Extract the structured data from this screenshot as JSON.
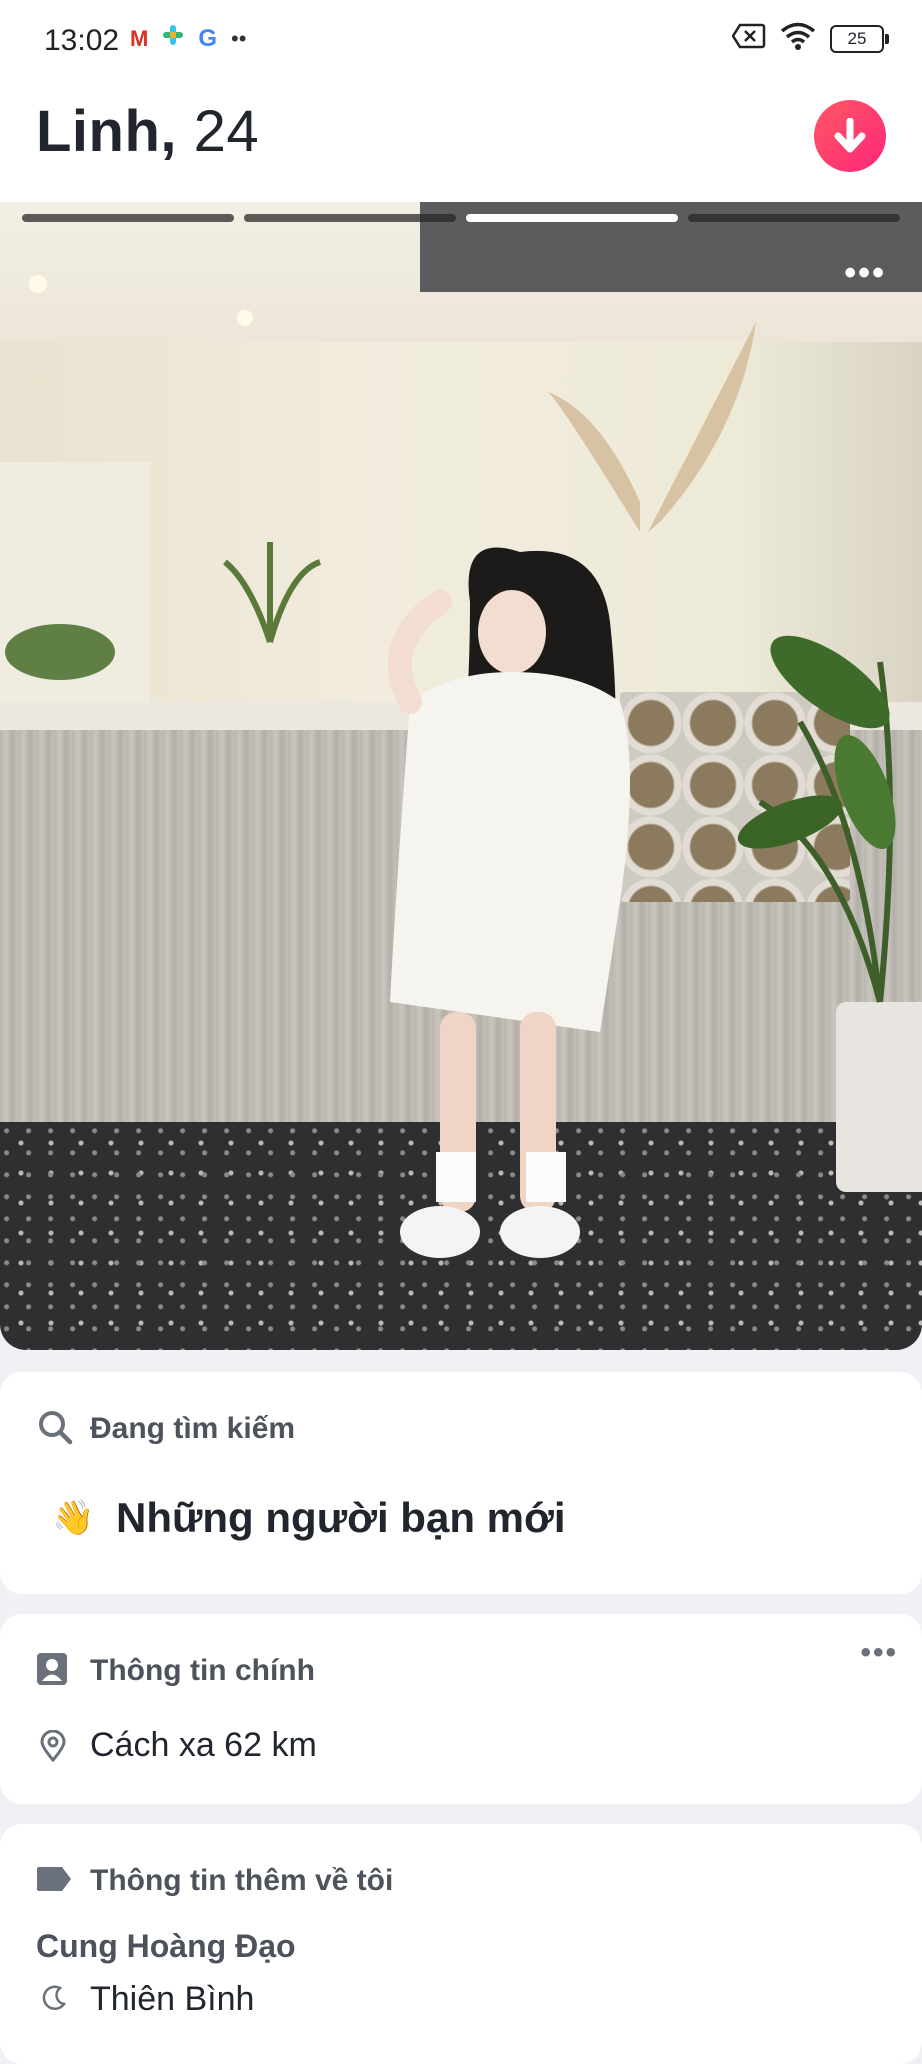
{
  "status_bar": {
    "time": "13:02",
    "app_icons": [
      "gmail-icon",
      "slack-icon",
      "google-icon"
    ],
    "overflow": "••",
    "battery": "25"
  },
  "profile": {
    "name": "Linh,",
    "age": "24"
  },
  "photo": {
    "count": 4,
    "active_index": 3,
    "more": "•••"
  },
  "looking_for": {
    "title": "Đang tìm kiếm",
    "emoji": "👋",
    "value": "Những người bạn mới"
  },
  "basics": {
    "title": "Thông tin chính",
    "more": "•••",
    "distance": "Cách xa 62 km"
  },
  "more_about": {
    "title": "Thông tin thêm về tôi",
    "zodiac_label": "Cung Hoàng Đạo",
    "zodiac_value": "Thiên Bình"
  },
  "colors": {
    "accent_start": "#ff5864",
    "accent_end": "#fd267a",
    "card_bg": "#ffffff",
    "page_bg": "#f0f1f4"
  }
}
